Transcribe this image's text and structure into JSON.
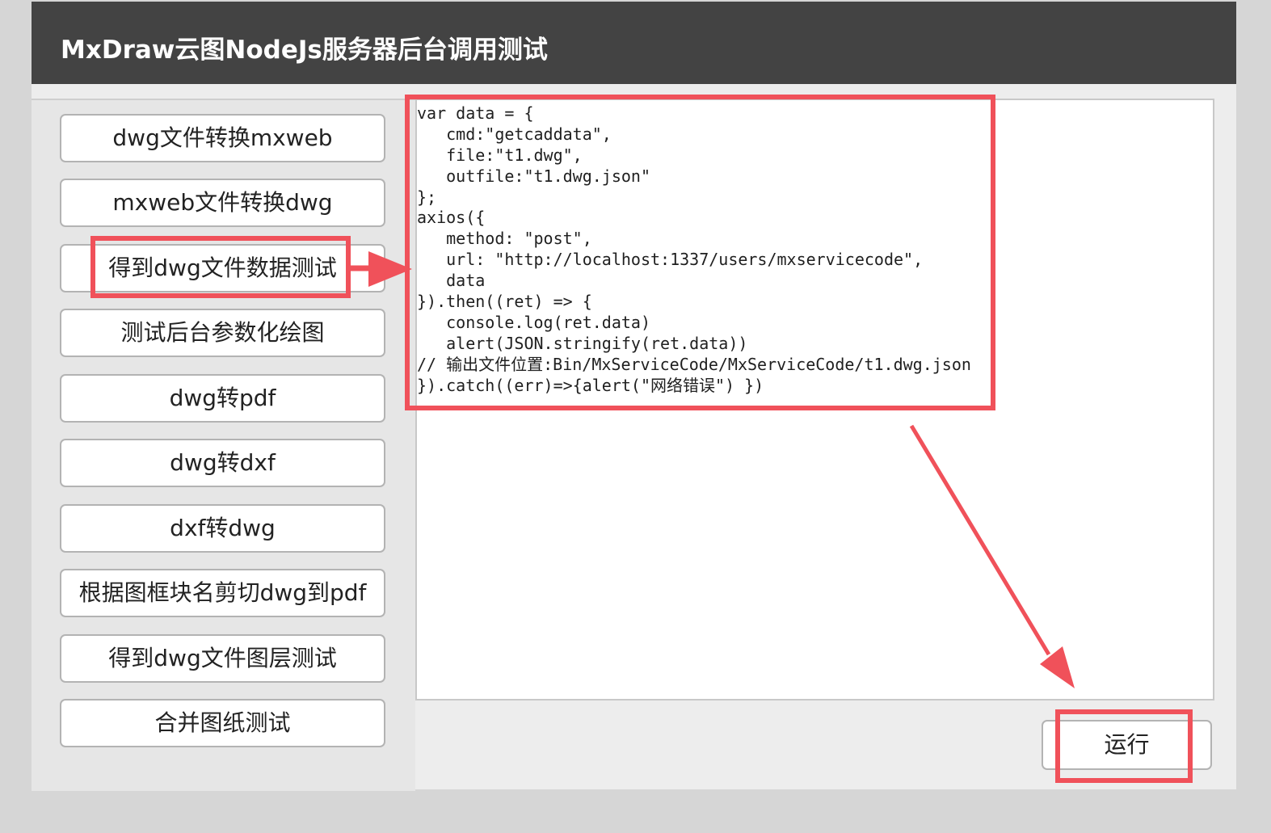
{
  "header": {
    "title": "MxDraw云图NodeJs服务器后台调用测试"
  },
  "sidebar": {
    "buttons": [
      {
        "label": "dwg文件转换mxweb"
      },
      {
        "label": "mxweb文件转换dwg"
      },
      {
        "label": "得到dwg文件数据测试"
      },
      {
        "label": "测试后台参数化绘图"
      },
      {
        "label": "dwg转pdf"
      },
      {
        "label": "dwg转dxf"
      },
      {
        "label": "dxf转dwg"
      },
      {
        "label": "根据图框块名剪切dwg到pdf"
      },
      {
        "label": "得到dwg文件图层测试"
      },
      {
        "label": "合并图纸测试"
      }
    ]
  },
  "editor": {
    "lines": [
      "var data = {",
      "   cmd:\"getcaddata\",",
      "   file:\"t1.dwg\",",
      "   outfile:\"t1.dwg.json\"",
      "};",
      "axios({",
      "   method: \"post\",",
      "   url: \"http://localhost:1337/users/mxservicecode\",",
      "   data",
      "}).then((ret) => {",
      "   console.log(ret.data)",
      "   alert(JSON.stringify(ret.data))",
      "// 输出文件位置:Bin/MxServiceCode/MxServiceCode/t1.dwg.json",
      "}).catch((err)=>{alert(\"网络错误\") })"
    ]
  },
  "actions": {
    "run_label": "运行"
  },
  "colors": {
    "header_bg": "#434343",
    "highlight_red": "#f0515a",
    "panel_bg": "#ededed"
  }
}
